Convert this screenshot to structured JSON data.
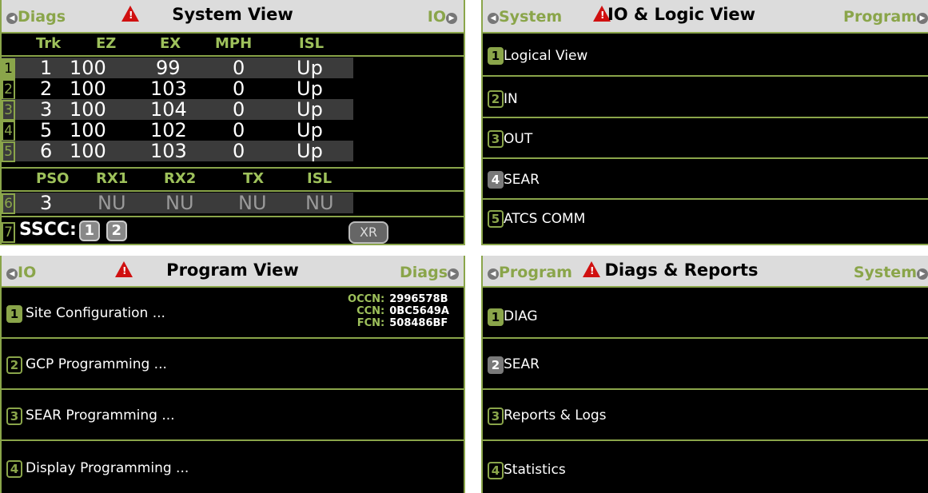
{
  "system_view": {
    "left_nav": "Diags",
    "title": "System View",
    "right_nav": "IO",
    "track_headers": [
      "Trk",
      "EZ",
      "EX",
      "MPH",
      "ISL"
    ],
    "track_rows": [
      {
        "num": "1",
        "trk": "1",
        "ez": "100",
        "ex": "99",
        "mph": "0",
        "isl": "Up"
      },
      {
        "num": "2",
        "trk": "2",
        "ez": "100",
        "ex": "103",
        "mph": "0",
        "isl": "Up"
      },
      {
        "num": "3",
        "trk": "3",
        "ez": "100",
        "ex": "104",
        "mph": "0",
        "isl": "Up"
      },
      {
        "num": "4",
        "trk": "5",
        "ez": "100",
        "ex": "102",
        "mph": "0",
        "isl": "Up"
      },
      {
        "num": "5",
        "trk": "6",
        "ez": "100",
        "ex": "103",
        "mph": "0",
        "isl": "Up"
      }
    ],
    "pso_headers": [
      "PSO",
      "RX1",
      "RX2",
      "TX",
      "ISL"
    ],
    "pso_row": {
      "num": "6",
      "pso": "3",
      "rx1": "NU",
      "rx2": "NU",
      "tx": "NU",
      "isl": "NU"
    },
    "footer_num": "7",
    "sscc_label": "SSCC:",
    "sscc_buttons": [
      "1",
      "2"
    ],
    "xr_button": "XR"
  },
  "io_view": {
    "left_nav": "System",
    "title": "IO & Logic View",
    "right_nav": "Program",
    "items": [
      {
        "num": "1",
        "label": "Logical View"
      },
      {
        "num": "2",
        "label": "IN"
      },
      {
        "num": "3",
        "label": "OUT"
      },
      {
        "num": "4",
        "label": "SEAR"
      },
      {
        "num": "5",
        "label": "ATCS COMM"
      }
    ]
  },
  "program_view": {
    "left_nav": "IO",
    "title": "Program View",
    "right_nav": "Diags",
    "occn_label": "OCCN:",
    "occn": "2996578B",
    "ccn_label": "CCN:",
    "ccn": "0BC5649A",
    "fcn_label": "FCN:",
    "fcn": "508486BF",
    "items": [
      {
        "num": "1",
        "label": "Site Configuration ..."
      },
      {
        "num": "2",
        "label": "GCP Programming ..."
      },
      {
        "num": "3",
        "label": "SEAR Programming ..."
      },
      {
        "num": "4",
        "label": "Display Programming ..."
      }
    ]
  },
  "diags_view": {
    "left_nav": "Program",
    "title": "Diags & Reports",
    "right_nav": "System",
    "items": [
      {
        "num": "1",
        "label": "DIAG"
      },
      {
        "num": "2",
        "label": "SEAR"
      },
      {
        "num": "3",
        "label": "Reports & Logs"
      },
      {
        "num": "4",
        "label": "Statistics"
      }
    ]
  },
  "colors": {
    "accent": "#8aa54a",
    "header_bg": "#dcdcdc",
    "alert": "#d01010",
    "screen_bg": "#000000"
  },
  "icons": {
    "alert": "warning-triangle-icon",
    "nav_left": "left-arrow-icon",
    "nav_right": "right-arrow-icon"
  }
}
